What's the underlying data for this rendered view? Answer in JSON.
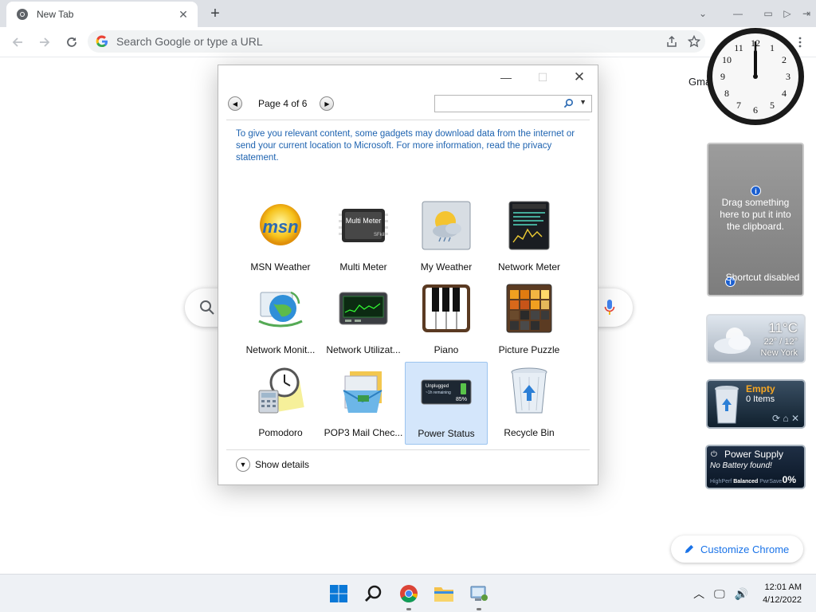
{
  "browser": {
    "tab_title": "New Tab",
    "omnibox_placeholder": "Search Google or type a URL",
    "gmail_label": "Gma",
    "customize_label": "Customize Chrome"
  },
  "dialog": {
    "page_label": "Page 4 of 6",
    "search_value": "",
    "notice": "To give you relevant content, some gadgets may download data from the internet or send your current location to Microsoft. For more information, read the privacy statement.",
    "gadgets": [
      {
        "label": "MSN Weather",
        "icon": "msn-weather-icon"
      },
      {
        "label": "Multi Meter",
        "icon": "multi-meter-icon"
      },
      {
        "label": "My Weather",
        "icon": "my-weather-icon"
      },
      {
        "label": "Network Meter",
        "icon": "network-meter-icon"
      },
      {
        "label": "Network Monit...",
        "icon": "network-monitor-icon"
      },
      {
        "label": "Network Utilizat...",
        "icon": "network-utilization-icon"
      },
      {
        "label": "Piano",
        "icon": "piano-icon"
      },
      {
        "label": "Picture Puzzle",
        "icon": "picture-puzzle-icon"
      },
      {
        "label": "Pomodoro",
        "icon": "pomodoro-icon"
      },
      {
        "label": "POP3 Mail Chec...",
        "icon": "pop3-mail-icon"
      },
      {
        "label": "Power Status",
        "icon": "power-status-icon",
        "selected": true
      },
      {
        "label": "Recycle Bin",
        "icon": "recycle-bin-icon"
      }
    ],
    "show_details": "Show details"
  },
  "sidebar": {
    "clipboard_text": "Drag something here to put it into the clipboard.",
    "shortcut_text": "Shortcut disabled",
    "weather": {
      "temp": "11°C",
      "range": "22° / 12°",
      "city": "New York"
    },
    "recycle": {
      "status": "Empty",
      "count": "0 Items"
    },
    "power": {
      "title": "Power Supply",
      "message": "No Battery found!",
      "modes": [
        "HighPerf",
        "Balanced",
        "PwrSave"
      ],
      "percent": "0%"
    }
  },
  "taskbar": {
    "time": "12:01 AM",
    "date": "4/12/2022"
  }
}
